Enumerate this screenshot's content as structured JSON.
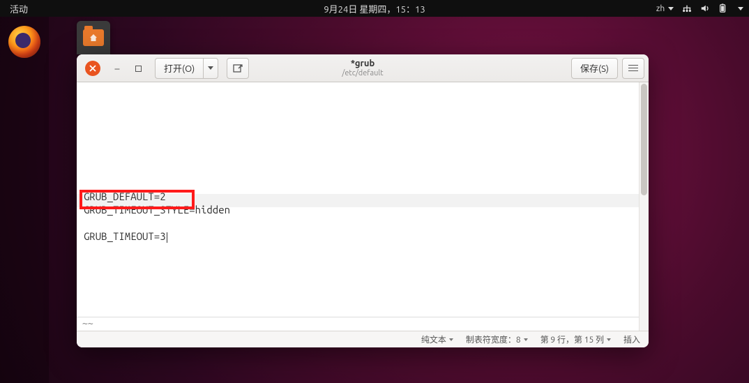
{
  "topbar": {
    "activities": "活动",
    "clock": "9月24日 星期四，15：13",
    "ime": "zh"
  },
  "editor_window": {
    "open_label": "打开(O)",
    "title": "*grub",
    "subtitle": "/etc/default",
    "save_label": "保存(S)"
  },
  "editor_content": {
    "lines": [
      "",
      "",
      "",
      "",
      "",
      "GRUB_DEFAULT=2",
      "GRUB_TIMEOUT_STYLE=hidden",
      "",
      "GRUB_TIMEOUT=3"
    ],
    "highlighted_line_index": 8,
    "cursor_line_index": 8
  },
  "statusbar": {
    "syntax": "纯文本",
    "tab_label": "制表符宽度：",
    "tab_value": "8",
    "position": "第 9 行，第 15 列",
    "mode": "插入"
  },
  "annotation": {
    "red_box_target": "GRUB_TIMEOUT=3"
  }
}
